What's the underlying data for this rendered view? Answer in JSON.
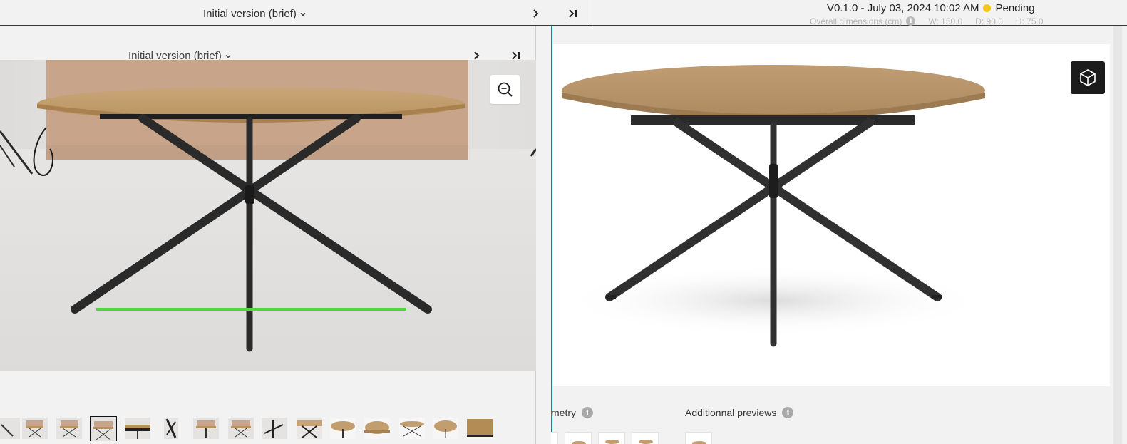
{
  "top_header": {
    "version_title": "Initial version (brief)",
    "version_info": "V0.1.0 - July 03, 2024 10:02 AM",
    "status": "Pending",
    "dimensions_label": "Overall dimensions (cm)",
    "width": "W: 150.0",
    "depth": "D: 90.0",
    "height": "H: 75.0"
  },
  "left_panel": {
    "version_title": "Initial version (brief)",
    "thumbnail_count": 15,
    "selected_thumbnail": 3
  },
  "right_panel": {
    "geometry_label": "metry",
    "previews_label": "Additionnal previews"
  },
  "colors": {
    "accent_teal": "#0f8a8a",
    "status_pending": "#f5c518",
    "measure_line": "#4cd93a"
  },
  "icons": {
    "dropdown": "chevron-down-icon",
    "next": "chevron-right-icon",
    "last": "skip-to-last-icon",
    "zoom": "zoom-out-icon",
    "view3d": "cube-3d-icon",
    "info": "info-icon"
  }
}
